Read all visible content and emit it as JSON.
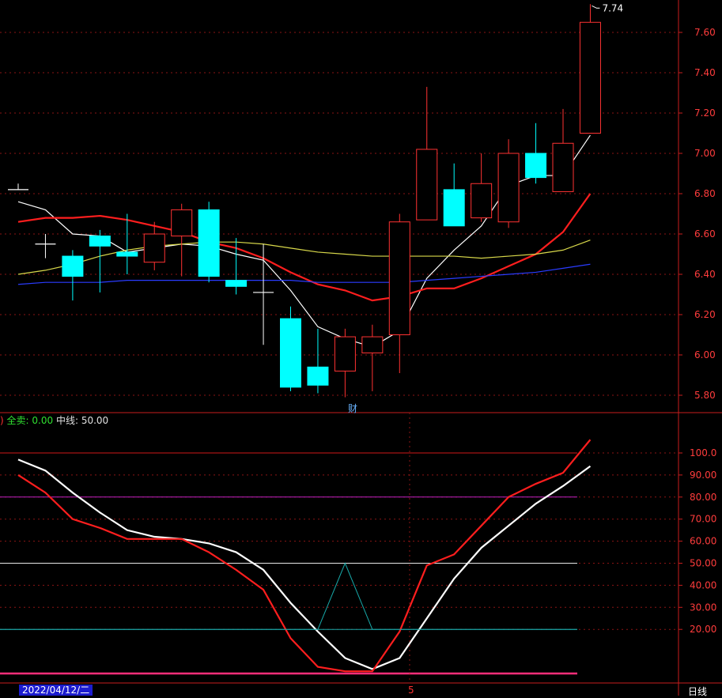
{
  "chart_data": [
    {
      "type": "candlestick",
      "title": "",
      "ylim": [
        5.72,
        7.78
      ],
      "y_ticks": [
        "5.80",
        "6.00",
        "6.20",
        "6.40",
        "6.60",
        "6.80",
        "7.00",
        "7.20",
        "7.40",
        "7.60"
      ],
      "max_label": "7.74",
      "candles": [
        {
          "open": 6.82,
          "close": 6.82,
          "high": 6.85,
          "low": 6.82
        },
        {
          "open": 6.55,
          "close": 6.55,
          "high": 6.6,
          "low": 6.48
        },
        {
          "open": 6.49,
          "close": 6.39,
          "high": 6.52,
          "low": 6.27
        },
        {
          "open": 6.59,
          "close": 6.54,
          "high": 6.62,
          "low": 6.31
        },
        {
          "open": 6.51,
          "close": 6.49,
          "high": 6.7,
          "low": 6.4
        },
        {
          "open": 6.46,
          "close": 6.6,
          "high": 6.66,
          "low": 6.42
        },
        {
          "open": 6.59,
          "close": 6.72,
          "high": 6.75,
          "low": 6.39
        },
        {
          "open": 6.72,
          "close": 6.39,
          "high": 6.76,
          "low": 6.36
        },
        {
          "open": 6.37,
          "close": 6.34,
          "high": 6.58,
          "low": 6.3
        },
        {
          "open": 6.31,
          "close": 6.31,
          "high": 6.55,
          "low": 6.05
        },
        {
          "open": 6.18,
          "close": 5.84,
          "high": 6.24,
          "low": 5.82
        },
        {
          "open": 5.94,
          "close": 5.85,
          "high": 6.13,
          "low": 5.81
        },
        {
          "open": 5.92,
          "close": 6.09,
          "high": 6.13,
          "low": 5.79
        },
        {
          "open": 6.01,
          "close": 6.09,
          "high": 6.15,
          "low": 5.82
        },
        {
          "open": 6.1,
          "close": 6.66,
          "high": 6.7,
          "low": 5.91
        },
        {
          "open": 6.67,
          "close": 7.02,
          "high": 7.33,
          "low": 6.67
        },
        {
          "open": 6.82,
          "close": 6.64,
          "high": 6.95,
          "low": 6.64
        },
        {
          "open": 6.68,
          "close": 6.85,
          "high": 7.0,
          "low": 6.66
        },
        {
          "open": 6.66,
          "close": 7.0,
          "high": 7.07,
          "low": 6.63
        },
        {
          "open": 7.0,
          "close": 6.88,
          "high": 7.15,
          "low": 6.85
        },
        {
          "open": 6.81,
          "close": 7.05,
          "high": 7.22,
          "low": 6.81
        },
        {
          "open": 7.1,
          "close": 7.65,
          "high": 7.74,
          "low": 7.1
        }
      ],
      "series": [
        {
          "color": "#ffffff",
          "values": [
            6.76,
            6.72,
            6.6,
            6.59,
            6.51,
            6.53,
            6.55,
            6.54,
            6.5,
            6.47,
            6.32,
            6.14,
            6.08,
            6.04,
            6.12,
            6.38,
            6.52,
            6.64,
            6.84,
            6.89,
            6.89,
            7.09
          ]
        },
        {
          "color": "#ff1e1e",
          "values": [
            6.66,
            6.68,
            6.68,
            6.69,
            6.67,
            6.64,
            6.61,
            6.56,
            6.53,
            6.48,
            6.41,
            6.35,
            6.32,
            6.27,
            6.29,
            6.33,
            6.33,
            6.38,
            6.44,
            6.5,
            6.61,
            6.8
          ]
        },
        {
          "color": "#d8d84a",
          "values": [
            6.4,
            6.42,
            6.45,
            6.49,
            6.52,
            6.54,
            6.55,
            6.56,
            6.56,
            6.55,
            6.53,
            6.51,
            6.5,
            6.49,
            6.49,
            6.49,
            6.49,
            6.48,
            6.49,
            6.5,
            6.52,
            6.57
          ]
        },
        {
          "color": "#2a3cff",
          "values": [
            6.35,
            6.36,
            6.36,
            6.36,
            6.37,
            6.37,
            6.37,
            6.37,
            6.37,
            6.37,
            6.37,
            6.36,
            6.36,
            6.36,
            6.36,
            6.37,
            6.38,
            6.39,
            6.4,
            6.41,
            6.43,
            6.45
          ]
        }
      ]
    },
    {
      "type": "line",
      "title": "",
      "ylim": [
        -2,
        110
      ],
      "y_ticks": [
        "20.00",
        "30.00",
        "40.00",
        "50.00",
        "60.00",
        "70.00",
        "80.00",
        "90.00",
        "100.0"
      ],
      "label_prefix": ")",
      "label_quanmai": "全卖:",
      "label_quanmai_value": "0.00",
      "label_zhongxian": "中线:",
      "label_zhongxian_value": "50.00",
      "hlines": [
        {
          "value": 100,
          "color": "#d01818"
        },
        {
          "value": 80,
          "color": "#c020c0"
        },
        {
          "value": 50,
          "color": "#e8e8e8"
        },
        {
          "value": 20,
          "color": "#18a8a8"
        },
        {
          "value": 0,
          "color": "#ff2e7a"
        }
      ],
      "series": [
        {
          "color": "#ffffff",
          "values": [
            97,
            92,
            82,
            73,
            65,
            62,
            61,
            59,
            55,
            47,
            32,
            19,
            7,
            2,
            7,
            25,
            43,
            57,
            67,
            77,
            85,
            94
          ]
        },
        {
          "color": "#ff1e1e",
          "values": [
            90,
            82,
            70,
            66,
            61,
            61,
            61,
            55,
            47,
            38,
            16,
            3,
            1,
            1,
            19,
            49,
            54,
            67,
            80,
            86,
            91,
            106
          ]
        },
        {
          "color": "#18a8a8",
          "values": [
            null,
            null,
            null,
            null,
            null,
            null,
            null,
            null,
            null,
            null,
            null,
            20,
            50,
            20,
            null,
            null,
            null,
            null,
            null,
            null,
            null,
            null
          ]
        }
      ]
    }
  ],
  "labels": {
    "date": "2022/04/12/二",
    "x_mid": "5",
    "daily": "日线",
    "cai": "财"
  },
  "colors": {
    "up": "#ff3232",
    "down": "#00ffff",
    "grid": "#8c1414",
    "axis": "#c81e1e",
    "tick_text": "#ff3c3c"
  }
}
